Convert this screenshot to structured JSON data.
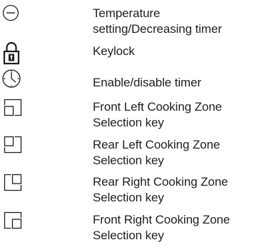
{
  "legend": {
    "items": [
      {
        "icon": "minus-circle-icon",
        "lines": [
          "Temperature",
          "setting/Decreasing timer"
        ]
      },
      {
        "icon": "keylock-icon",
        "lines": [
          "Keylock"
        ]
      },
      {
        "icon": "timer-icon",
        "lines": [
          "Enable/disable timer"
        ]
      },
      {
        "icon": "front-left-zone-icon",
        "lines": [
          "Front Left Cooking Zone",
          "Selection key"
        ]
      },
      {
        "icon": "rear-left-zone-icon",
        "lines": [
          "Rear Left Cooking Zone",
          "Selection key"
        ]
      },
      {
        "icon": "rear-right-zone-icon",
        "lines": [
          "Rear Right Cooking Zone",
          "Selection key"
        ]
      },
      {
        "icon": "front-right-zone-icon",
        "lines": [
          "Front Right Cooking Zone",
          "Selection key"
        ]
      }
    ]
  }
}
